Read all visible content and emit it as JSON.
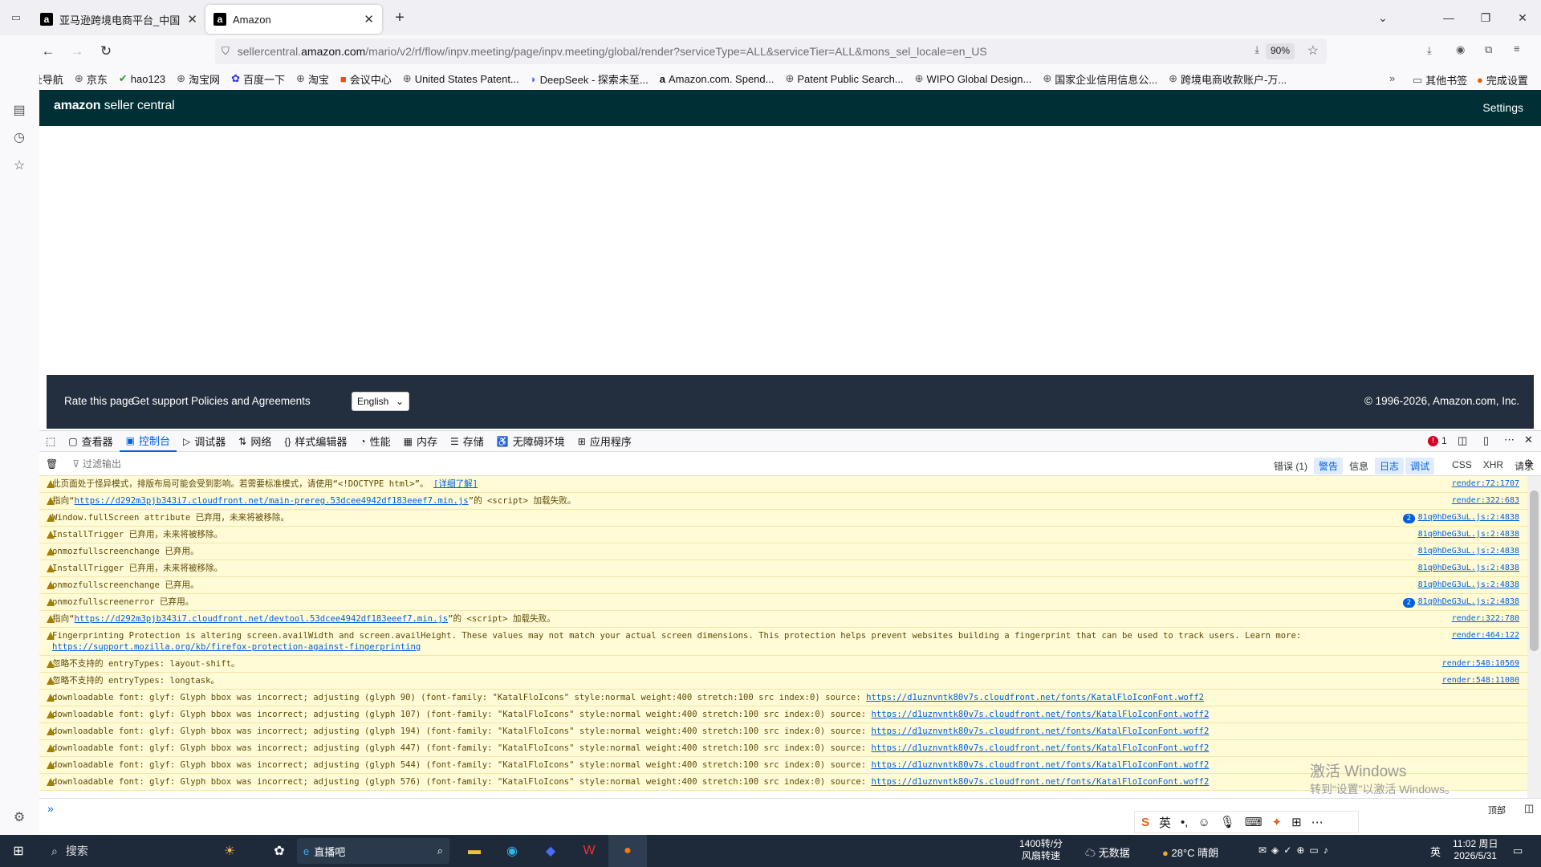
{
  "browser": {
    "tabs": [
      {
        "label": "亚马逊跨境电商平台_中国卖家",
        "favicon": "a"
      },
      {
        "label": "Amazon",
        "favicon": "a"
      }
    ],
    "url_prefix": "sellercentral.",
    "url_domain": "amazon.com",
    "url_path": "/mario/v2/rf/flow/inpv.meeting/page/inpv.meeting/global/render?serviceType=ALL&serviceTier=ALL&mons_sel_locale=en_US",
    "zoom": "90%",
    "bookmarks": [
      "网址导航",
      "京东",
      "hao123",
      "淘宝网",
      "百度一下",
      "淘宝",
      "会议中心",
      "United States Patent...",
      "DeepSeek - 探索未至...",
      "Amazon.com. Spend...",
      "Patent Public Search...",
      "WIPO Global Design...",
      "国家企业信用信息公...",
      "跨境电商收款账户-万..."
    ],
    "bookmarks_other": "其他书签",
    "bookmarks_finish": "完成设置"
  },
  "seller": {
    "logo_bold": "amazon",
    "logo_rest": " seller central",
    "settings": "Settings",
    "footer": {
      "rate": "Rate this page",
      "support": "Get support",
      "policies": "Policies and Agreements",
      "language": "English",
      "copyright": "© 1996-2026, Amazon.com, Inc."
    }
  },
  "devtools": {
    "tabs": [
      "查看器",
      "控制台",
      "调试器",
      "网络",
      "样式编辑器",
      "性能",
      "内存",
      "存储",
      "无障碍环境",
      "应用程序"
    ],
    "error_count": "1",
    "filter_placeholder": "过滤输出",
    "filters": [
      "错误 (1)",
      "警告",
      "信息",
      "日志",
      "调试",
      "CSS",
      "XHR",
      "请求"
    ],
    "messages": [
      {
        "pre": "此页面处于怪异模式，排版布局可能会受到影响。若需要标准模式，请使用“<!DOCTYPE html>”。 ",
        "link": "[详细了解]",
        "post": "",
        "src": "render:72:1707",
        "count": ""
      },
      {
        "pre": "指向“",
        "link": "https://d292m3pjb343i7.cloudfront.net/main-prereg.53dcee4942df183eeef7.min.js",
        "post": "”的 <script> 加载失败。",
        "src": "render:322:683",
        "count": ""
      },
      {
        "pre": "Window.fullScreen attribute 已弃用，未来将被移除。",
        "link": "",
        "post": "",
        "src": "81q0hDeG3uL.js:2:4838",
        "count": "2"
      },
      {
        "pre": "InstallTrigger 已弃用，未来将被移除。",
        "link": "",
        "post": "",
        "src": "81q0hDeG3uL.js:2:4838",
        "count": ""
      },
      {
        "pre": "onmozfullscreenchange 已弃用。",
        "link": "",
        "post": "",
        "src": "81q0hDeG3uL.js:2:4838",
        "count": ""
      },
      {
        "pre": "InstallTrigger 已弃用，未来将被移除。",
        "link": "",
        "post": "",
        "src": "81q0hDeG3uL.js:2:4838",
        "count": ""
      },
      {
        "pre": "onmozfullscreenchange 已弃用。",
        "link": "",
        "post": "",
        "src": "81q0hDeG3uL.js:2:4838",
        "count": ""
      },
      {
        "pre": "onmozfullscreenerror 已弃用。",
        "link": "",
        "post": "",
        "src": "81q0hDeG3uL.js:2:4838",
        "count": "2"
      },
      {
        "pre": "指向“",
        "link": "https://d292m3pjb343i7.cloudfront.net/devtool.53dcee4942df183eeef7.min.js",
        "post": "”的 <script> 加载失败。",
        "src": "render:322:780",
        "count": ""
      },
      {
        "pre": "Fingerprinting Protection is altering screen.availWidth and screen.availHeight. These values may not match your actual screen dimensions. This protection helps prevent websites building a fingerprint that can be used to track users. Learn more: ",
        "link": "https://support.mozilla.org/kb/firefox-protection-against-fingerprinting",
        "post": "",
        "src": "render:464:122",
        "count": "",
        "tall": true
      },
      {
        "pre": "忽略不支持的 entryTypes: layout-shift。",
        "link": "",
        "post": "",
        "src": "render:548:10569",
        "count": ""
      },
      {
        "pre": "忽略不支持的 entryTypes: longtask。",
        "link": "",
        "post": "",
        "src": "render:548:11080",
        "count": ""
      },
      {
        "pre": "downloadable font: glyf: Glyph bbox was incorrect; adjusting (glyph 90) (font-family: \"KatalFloIcons\" style:normal weight:400 stretch:100 src index:0) source: ",
        "link": "https://d1uznvntk80v7s.cloudfront.net/fonts/KatalFloIconFont.woff2",
        "post": "",
        "src": "",
        "count": ""
      },
      {
        "pre": "downloadable font: glyf: Glyph bbox was incorrect; adjusting (glyph 107) (font-family: \"KatalFloIcons\" style:normal weight:400 stretch:100 src index:0) source: ",
        "link": "https://d1uznvntk80v7s.cloudfront.net/fonts/KatalFloIconFont.woff2",
        "post": "",
        "src": "",
        "count": ""
      },
      {
        "pre": "downloadable font: glyf: Glyph bbox was incorrect; adjusting (glyph 194) (font-family: \"KatalFloIcons\" style:normal weight:400 stretch:100 src index:0) source: ",
        "link": "https://d1uznvntk80v7s.cloudfront.net/fonts/KatalFloIconFont.woff2",
        "post": "",
        "src": "",
        "count": ""
      },
      {
        "pre": "downloadable font: glyf: Glyph bbox was incorrect; adjusting (glyph 447) (font-family: \"KatalFloIcons\" style:normal weight:400 stretch:100 src index:0) source: ",
        "link": "https://d1uznvntk80v7s.cloudfront.net/fonts/KatalFloIconFont.woff2",
        "post": "",
        "src": "",
        "count": ""
      },
      {
        "pre": "downloadable font: glyf: Glyph bbox was incorrect; adjusting (glyph 544) (font-family: \"KatalFloIcons\" style:normal weight:400 stretch:100 src index:0) source: ",
        "link": "https://d1uznvntk80v7s.cloudfront.net/fonts/KatalFloIconFont.woff2",
        "post": "",
        "src": "",
        "count": ""
      },
      {
        "pre": "downloadable font: glyf: Glyph bbox was incorrect; adjusting (glyph 576) (font-family: \"KatalFloIcons\" style:normal weight:400 stretch:100 src index:0) source: ",
        "link": "https://d1uznvntk80v7s.cloudfront.net/fonts/KatalFloIconFont.woff2",
        "post": "",
        "src": "",
        "count": ""
      }
    ],
    "input_context": "顶部"
  },
  "watermark": {
    "line1": "激活 Windows",
    "line2": "转到“设置”以激活 Windows。"
  },
  "taskbar": {
    "search": "搜索",
    "app_input": "直播吧",
    "net_speed": "1400转/分",
    "net_speed2": "风扇转速",
    "weather_cloud": "无数据",
    "temperature": "28°C 晴朗",
    "ime": "英",
    "time": "11:02 周日",
    "date": "2026/5/31"
  }
}
